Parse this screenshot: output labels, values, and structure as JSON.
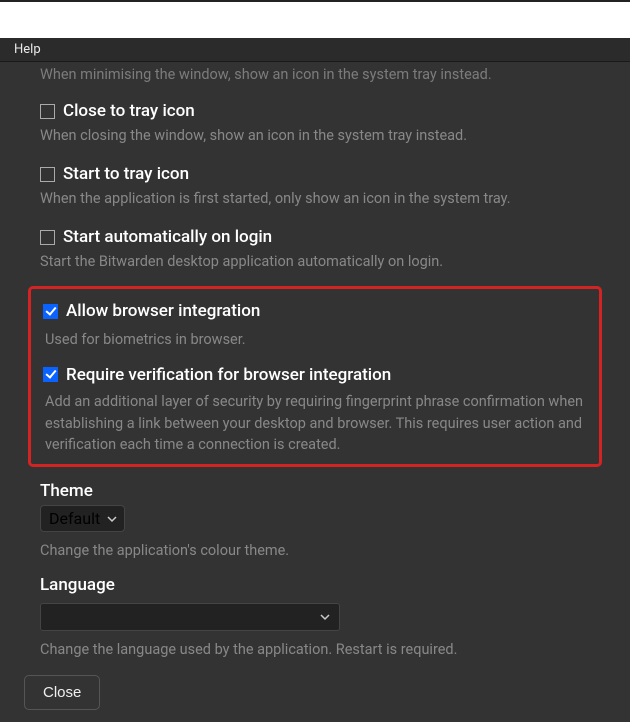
{
  "menu": {
    "help": "Help"
  },
  "cutoff_desc": "When minimising the window, show an icon in the system tray instead.",
  "settings": {
    "close_tray": {
      "label": "Close to tray icon",
      "desc": "When closing the window, show an icon in the system tray instead.",
      "checked": false
    },
    "start_tray": {
      "label": "Start to tray icon",
      "desc": "When the application is first started, only show an icon in the system tray.",
      "checked": false
    },
    "auto_login": {
      "label": "Start automatically on login",
      "desc": "Start the Bitwarden desktop application automatically on login.",
      "checked": false
    },
    "browser_int": {
      "label": "Allow browser integration",
      "desc": "Used for biometrics in browser.",
      "checked": true
    },
    "verify_int": {
      "label": "Require verification for browser integration",
      "desc": "Add an additional layer of security by requiring fingerprint phrase confirmation when establishing a link between your desktop and browser. This requires user action and verification each time a connection is created.",
      "checked": true
    }
  },
  "theme": {
    "label": "Theme",
    "value": "Default",
    "desc": "Change the application's colour theme."
  },
  "language": {
    "label": "Language",
    "value": "",
    "desc": "Change the language used by the application. Restart is required."
  },
  "buttons": {
    "close": "Close"
  }
}
